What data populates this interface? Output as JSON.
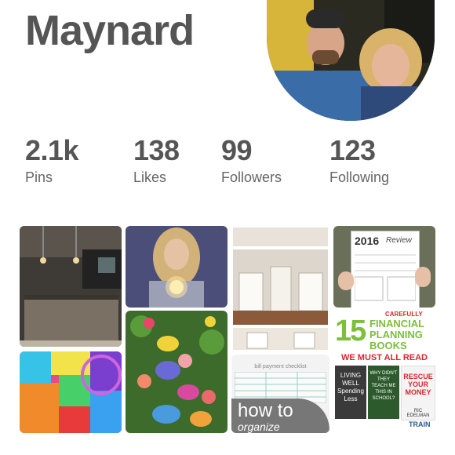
{
  "profile": {
    "name": "Maynard"
  },
  "stats": [
    {
      "value": "2.1k",
      "label": "Pins"
    },
    {
      "value": "138",
      "label": "Likes"
    },
    {
      "value": "99",
      "label": "Followers"
    },
    {
      "value": "123",
      "label": "Following"
    }
  ],
  "pins": {
    "review_year": "2016",
    "review_title": "Review",
    "checklist_title": "bill payment checklist",
    "howto_text": "how to",
    "howto_text2": "organize",
    "book_number": "15",
    "book_line1": "FINANCIAL",
    "book_line2": "PLANNING",
    "book_line3": "BOOKS",
    "book_line4": "WE MUST ALL READ",
    "book_carefully": "CAREFULLY",
    "book1": "LIVING WELL Spending Less",
    "book2": "WHY DIDN'T THEY TEACH ME THIS IN SCHOOL?",
    "book3": "RESCUE YOUR MONEY",
    "book3_author": "RIC EDELMAN",
    "book_train": "TRAIN"
  },
  "colors": {
    "name": "#555555",
    "book_green": "#7cbf3a",
    "book_red": "#d9262c"
  }
}
